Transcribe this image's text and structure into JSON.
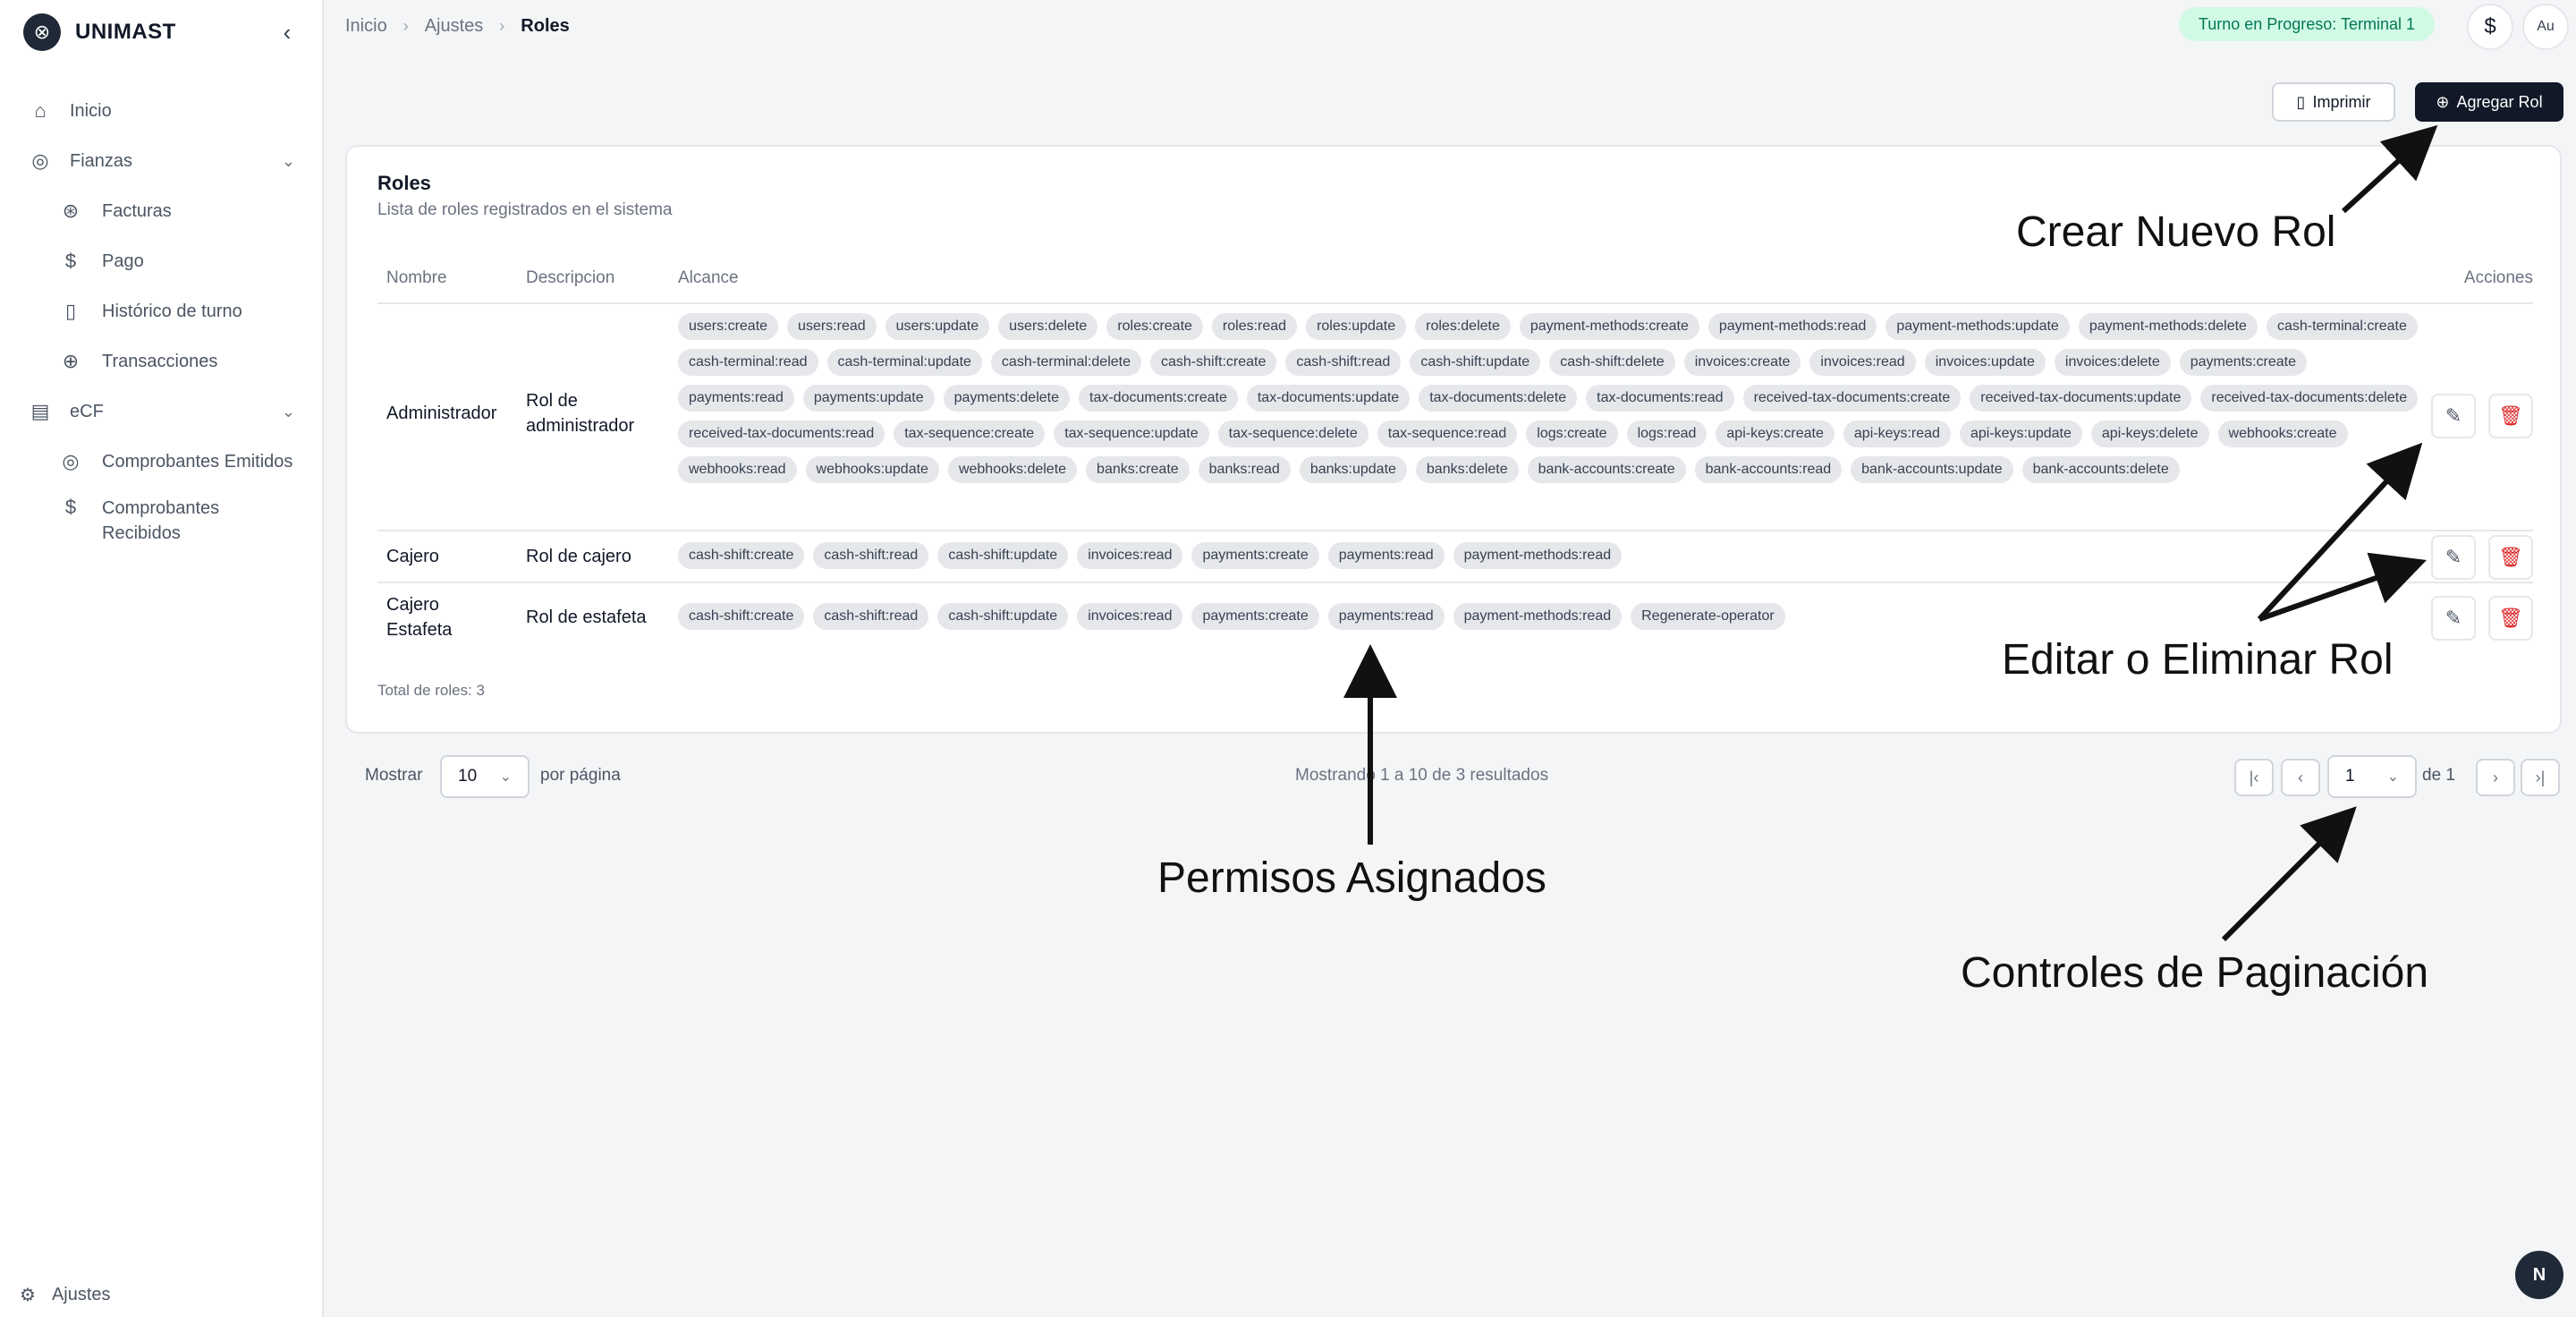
{
  "sidebar": {
    "brand": "UNIMAST",
    "collapse_icon": "chevron-left-icon",
    "items": [
      {
        "label": "Inicio",
        "icon": "home-icon"
      },
      {
        "label": "Fianzas",
        "icon": "coins-icon"
      },
      {
        "label": "Facturas",
        "icon": "receipt-icon"
      },
      {
        "label": "Pago",
        "icon": "dollar-icon"
      },
      {
        "label": "Histórico de turno",
        "icon": "book-icon"
      },
      {
        "label": "Transacciones",
        "icon": "globe-icon"
      },
      {
        "label": "eCF",
        "icon": "document-icon"
      },
      {
        "label": "Comprobantes Emitidos",
        "icon": "coins-icon"
      },
      {
        "label": "Comprobantes Recibidos",
        "icon": "dollar-icon"
      }
    ],
    "footer": {
      "label": "Ajustes",
      "icon": "gear-icon"
    }
  },
  "topbar": {
    "breadcrumb": [
      "Inicio",
      "Ajustes",
      "Roles"
    ],
    "turno_badge": "Turno en Progreso: Terminal 1",
    "currency_symbol": "$",
    "avatar_alt": "Au"
  },
  "actions": {
    "print_label": "Imprimir",
    "add_label": "Agregar Rol"
  },
  "card": {
    "title": "Roles",
    "subtitle": "Lista de roles registrados en el sistema",
    "columns": [
      "Nombre",
      "Descripcion",
      "Alcance",
      "Acciones"
    ],
    "rows": [
      {
        "name": "Administrador",
        "description": "Rol de administrador",
        "scopes": [
          "users:create",
          "users:read",
          "users:update",
          "users:delete",
          "roles:create",
          "roles:read",
          "roles:update",
          "roles:delete",
          "payment-methods:create",
          "payment-methods:read",
          "payment-methods:update",
          "payment-methods:delete",
          "cash-terminal:create",
          "cash-terminal:read",
          "cash-terminal:update",
          "cash-terminal:delete",
          "cash-shift:create",
          "cash-shift:read",
          "cash-shift:update",
          "cash-shift:delete",
          "invoices:create",
          "invoices:read",
          "invoices:update",
          "invoices:delete",
          "payments:create",
          "payments:read",
          "payments:update",
          "payments:delete",
          "tax-documents:create",
          "tax-documents:update",
          "tax-documents:delete",
          "tax-documents:read",
          "received-tax-documents:create",
          "received-tax-documents:update",
          "received-tax-documents:delete",
          "received-tax-documents:read",
          "tax-sequence:create",
          "tax-sequence:update",
          "tax-sequence:delete",
          "tax-sequence:read",
          "logs:create",
          "logs:read",
          "api-keys:create",
          "api-keys:read",
          "api-keys:update",
          "api-keys:delete",
          "webhooks:create",
          "webhooks:read",
          "webhooks:update",
          "webhooks:delete",
          "banks:create",
          "banks:read",
          "banks:update",
          "banks:delete",
          "bank-accounts:create",
          "bank-accounts:read",
          "bank-accounts:update",
          "bank-accounts:delete"
        ]
      },
      {
        "name": "Cajero",
        "description": "Rol de cajero",
        "scopes": [
          "cash-shift:create",
          "cash-shift:read",
          "cash-shift:update",
          "invoices:read",
          "payments:create",
          "payments:read",
          "payment-methods:read"
        ]
      },
      {
        "name": "Cajero Estafeta",
        "description": "Rol de estafeta",
        "scopes": [
          "cash-shift:create",
          "cash-shift:read",
          "cash-shift:update",
          "invoices:read",
          "payments:create",
          "payments:read",
          "payment-methods:read",
          "Regenerate-operator"
        ]
      }
    ],
    "total": "Total de roles: 3"
  },
  "pagination": {
    "show_label": "Mostrar",
    "per_page_value": "10",
    "per_page_label": "por página",
    "results": "Mostrando 1 a 10 de 3 resultados",
    "page_value": "1",
    "of_label": "de 1"
  },
  "annotations": {
    "create_role": "Crear Nuevo Rol",
    "edit_delete": "Editar o Eliminar Rol",
    "permissions": "Permisos Asignados",
    "pagination": "Controles de Paginación"
  },
  "colors": {
    "primary_dark": "#111827",
    "badge_green_bg": "#d1fae5",
    "badge_green_text": "#047857",
    "danger": "#dc2626",
    "chip_bg": "#e5e7eb"
  },
  "n_badge": "N"
}
